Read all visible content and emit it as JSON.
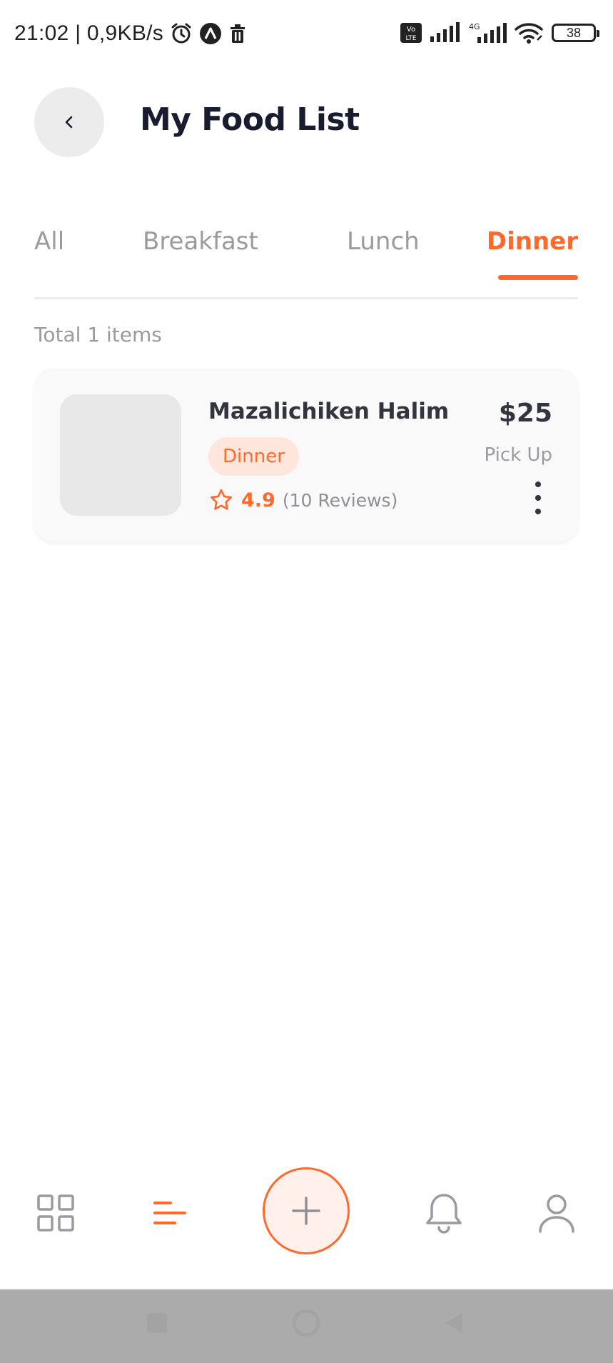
{
  "status_bar": {
    "time": "21:02 | 0,9KB/s",
    "network_4g": "4G",
    "battery": "38"
  },
  "header": {
    "title": "My Food List",
    "back_icon": "chevron-left-icon"
  },
  "tabs": [
    {
      "label": "All",
      "active": false
    },
    {
      "label": "Breakfast",
      "active": false
    },
    {
      "label": "Lunch",
      "active": false
    },
    {
      "label": "Dinner",
      "active": true
    }
  ],
  "summary": {
    "total_text": "Total 1 items"
  },
  "items": [
    {
      "name": "Mazalichiken Halim",
      "category": "Dinner",
      "rating": "4.9",
      "reviews": "(10 Reviews)",
      "price": "$25",
      "delivery": "Pick Up"
    }
  ],
  "bottom_nav": [
    {
      "icon": "grid-icon",
      "active": false
    },
    {
      "icon": "menu-list-icon",
      "active": true
    },
    {
      "icon": "plus-icon",
      "active": false
    },
    {
      "icon": "bell-icon",
      "active": false
    },
    {
      "icon": "user-icon",
      "active": false
    }
  ],
  "colors": {
    "accent": "#ff6a2c",
    "title": "#181c2e",
    "muted": "#9a9aa3",
    "card_bg": "#f9f9f9"
  }
}
